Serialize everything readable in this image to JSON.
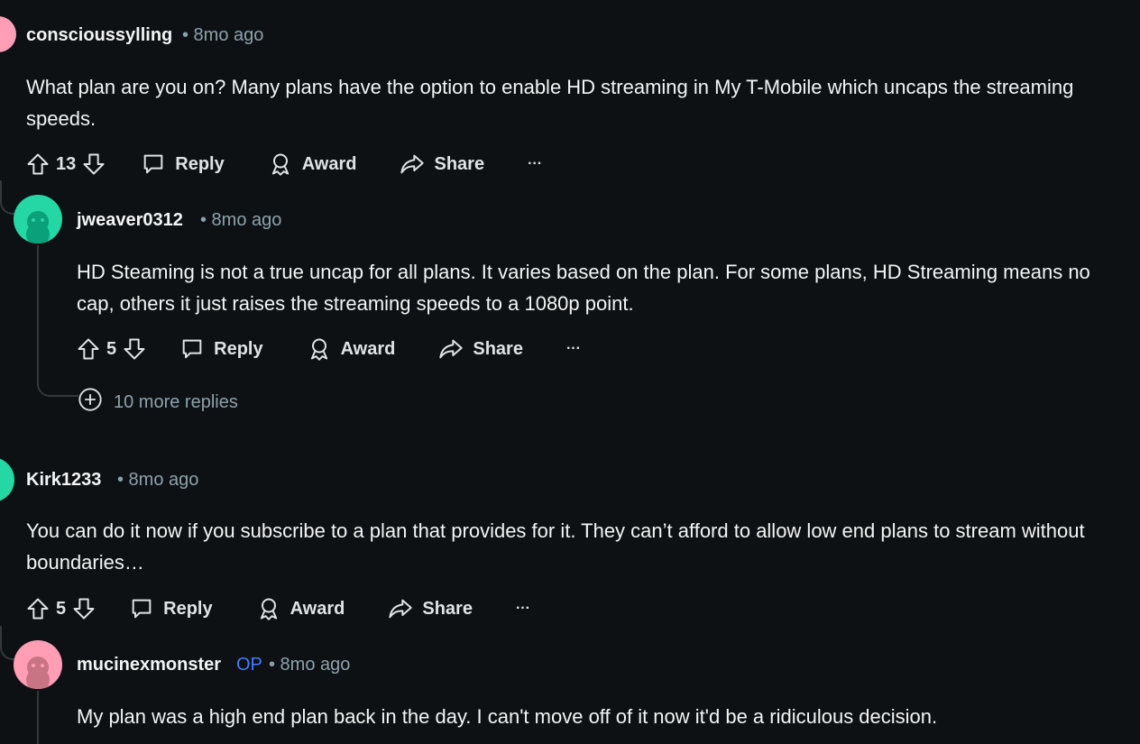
{
  "comments": [
    {
      "username": "conscioussylling",
      "time": "• 8mo ago",
      "body": "What plan are you on? Many plans have the option to enable HD streaming in My T-Mobile which uncaps the streaming speeds.",
      "votes": "13",
      "avatar_color": "#ff9eb5"
    },
    {
      "username": "jweaver0312",
      "time": "• 8mo ago",
      "body": "HD Steaming is not a true uncap for all plans. It varies based on the plan. For some plans, HD Streaming means no cap, others it just raises the streaming speeds to a 1080p point.",
      "votes": "5",
      "more_replies": "10 more replies",
      "avatar_color": "#24d7a4"
    },
    {
      "username": "Kirk1233",
      "time": "• 8mo ago",
      "body": "You can do it now if you subscribe to a plan that provides for it. They can’t afford to allow low end plans to stream without boundaries…",
      "votes": "5",
      "avatar_color": "#24d7a4"
    },
    {
      "username": "mucinexmonster",
      "op_badge": "OP",
      "time": "• 8mo ago",
      "body": "My plan was a high end plan back in the day. I can't move off of it now it'd be a ridiculous decision.",
      "avatar_color": "#ff9eb5"
    }
  ],
  "labels": {
    "reply": "Reply",
    "award": "Award",
    "share": "Share",
    "more": "···"
  },
  "icons": [
    "upvote-icon",
    "downvote-icon",
    "reply-icon",
    "award-icon",
    "share-icon",
    "more-icon",
    "plus-circle-icon"
  ]
}
